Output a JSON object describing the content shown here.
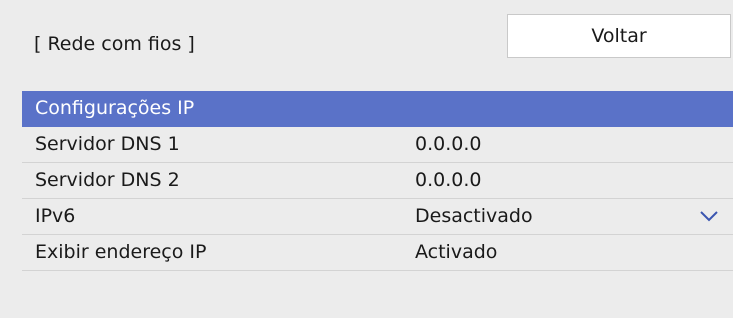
{
  "header": {
    "title": "[ Rede com fios ]",
    "back_label": "Voltar"
  },
  "menu": {
    "items": [
      {
        "label": "Configurações IP",
        "value": ""
      },
      {
        "label": "Servidor DNS 1",
        "value": "0.0.0.0"
      },
      {
        "label": "Servidor DNS 2",
        "value": "0.0.0.0"
      },
      {
        "label": "IPv6",
        "value": "Desactivado",
        "icon": "chevron-down-icon"
      },
      {
        "label": "Exibir endereço IP",
        "value": "Activado"
      }
    ]
  },
  "colors": {
    "selected_row": "#5a72c8",
    "background": "#ececec",
    "button_background": "#ffffff"
  }
}
